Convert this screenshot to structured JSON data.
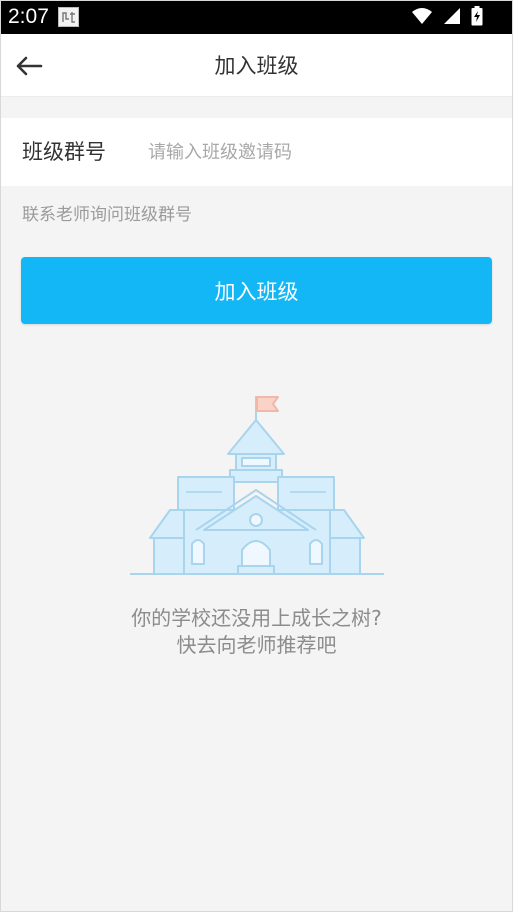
{
  "status_bar": {
    "time": "2:07",
    "icons": [
      "notification-icon",
      "wifi-icon",
      "signal-icon",
      "battery-charging-icon"
    ]
  },
  "header": {
    "back_icon": "arrow-left-icon",
    "title": "加入班级"
  },
  "form": {
    "label": "班级群号",
    "input_value": "",
    "placeholder": "请输入班级邀请码",
    "hint": "联系老师询问班级群号",
    "submit_label": "加入班级"
  },
  "empty_state": {
    "illustration": "school-building-icon",
    "line1": "你的学校还没用上成长之树?",
    "line2": "快去向老师推荐吧"
  },
  "colors": {
    "accent": "#14b7f5",
    "background": "#f4f4f4",
    "illustration_fill": "#d6eefb",
    "illustration_stroke": "#a9d4ee",
    "flag": "#fbd2c8"
  }
}
